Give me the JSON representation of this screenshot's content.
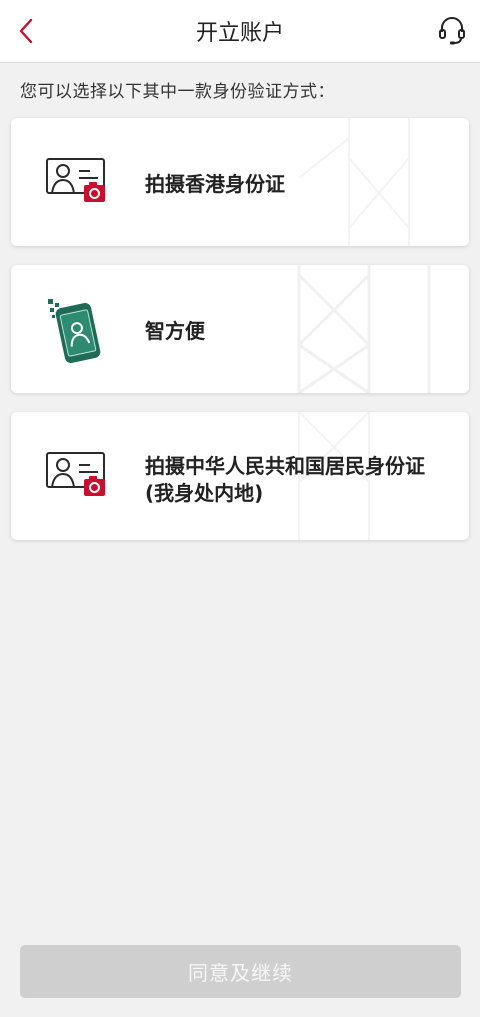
{
  "header": {
    "title": "开立账户",
    "back_icon": "chevron-left-icon",
    "support_icon": "headset-icon"
  },
  "instruction": "您可以选择以下其中一款身份验证方式：",
  "options": [
    {
      "label": "拍摄香港身份证",
      "icon": "id-card-camera-icon"
    },
    {
      "label": "智方便",
      "icon": "smartphone-identity-icon"
    },
    {
      "label": "拍摄中华人民共和国居民身份证(我身处内地)",
      "icon": "id-card-camera-icon"
    }
  ],
  "footer": {
    "continue_label": "同意及继续"
  },
  "colors": {
    "accent_red": "#c8102e",
    "iframe_green": "#1e6b57",
    "button_disabled": "#cfcfcf",
    "background": "#f1f1f1"
  }
}
